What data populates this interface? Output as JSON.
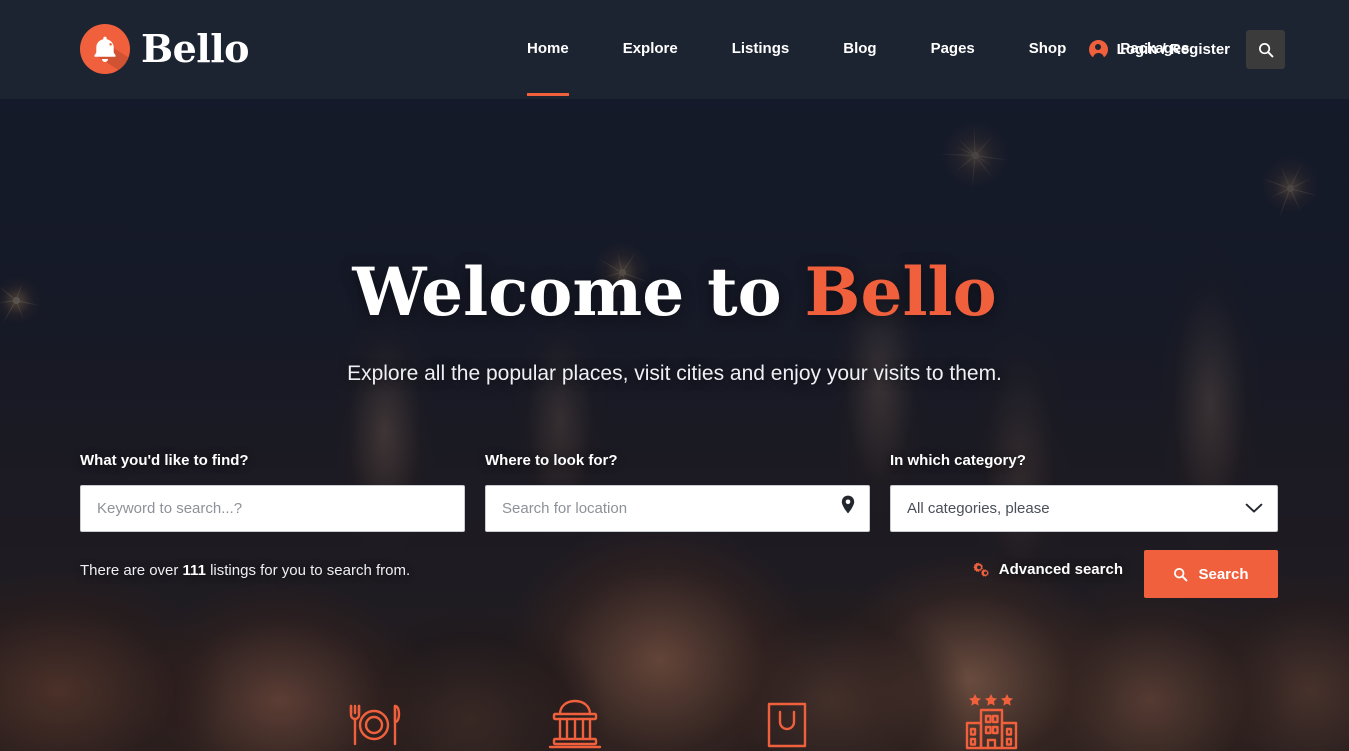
{
  "brand": {
    "name": "Bello",
    "logo_icon": "bell-icon",
    "accent_color": "#f1603c",
    "header_bg": "#1c2331"
  },
  "header": {
    "nav": [
      {
        "label": "Home",
        "active": true
      },
      {
        "label": "Explore",
        "active": false
      },
      {
        "label": "Listings",
        "active": false
      },
      {
        "label": "Blog",
        "active": false
      },
      {
        "label": "Pages",
        "active": false
      },
      {
        "label": "Shop",
        "active": false
      },
      {
        "label": "Packages",
        "active": false
      }
    ],
    "login_label": "Login / Register",
    "login_icon": "user-circle-icon",
    "search_icon": "search-icon"
  },
  "hero": {
    "title_lead": "Welcome to ",
    "title_accent": "Bello",
    "subtitle": "Explore all the popular places, visit cities and enjoy your visits to them."
  },
  "search_form": {
    "keyword": {
      "label": "What you'd like to find?",
      "placeholder": "Keyword to search...?",
      "value": ""
    },
    "location": {
      "label": "Where to look for?",
      "placeholder": "Search for location",
      "value": "",
      "icon": "map-pin-icon"
    },
    "category": {
      "label": "In which category?",
      "selected": "All categories, please",
      "icon": "chevron-down-icon",
      "options": [
        "All categories, please"
      ]
    },
    "listings_note_prefix": "There are over ",
    "listings_count": "111",
    "listings_note_suffix": " listings for you to search from.",
    "advanced_search_label": "Advanced search",
    "advanced_search_icon": "cogs-icon",
    "search_button_label": "Search",
    "search_button_icon": "search-icon"
  },
  "categories": [
    {
      "name": "restaurants",
      "icon": "restaurant-icon"
    },
    {
      "name": "museums",
      "icon": "museum-icon"
    },
    {
      "name": "shopping",
      "icon": "shopping-bag-icon"
    },
    {
      "name": "hotels",
      "icon": "hotel-icon"
    }
  ]
}
